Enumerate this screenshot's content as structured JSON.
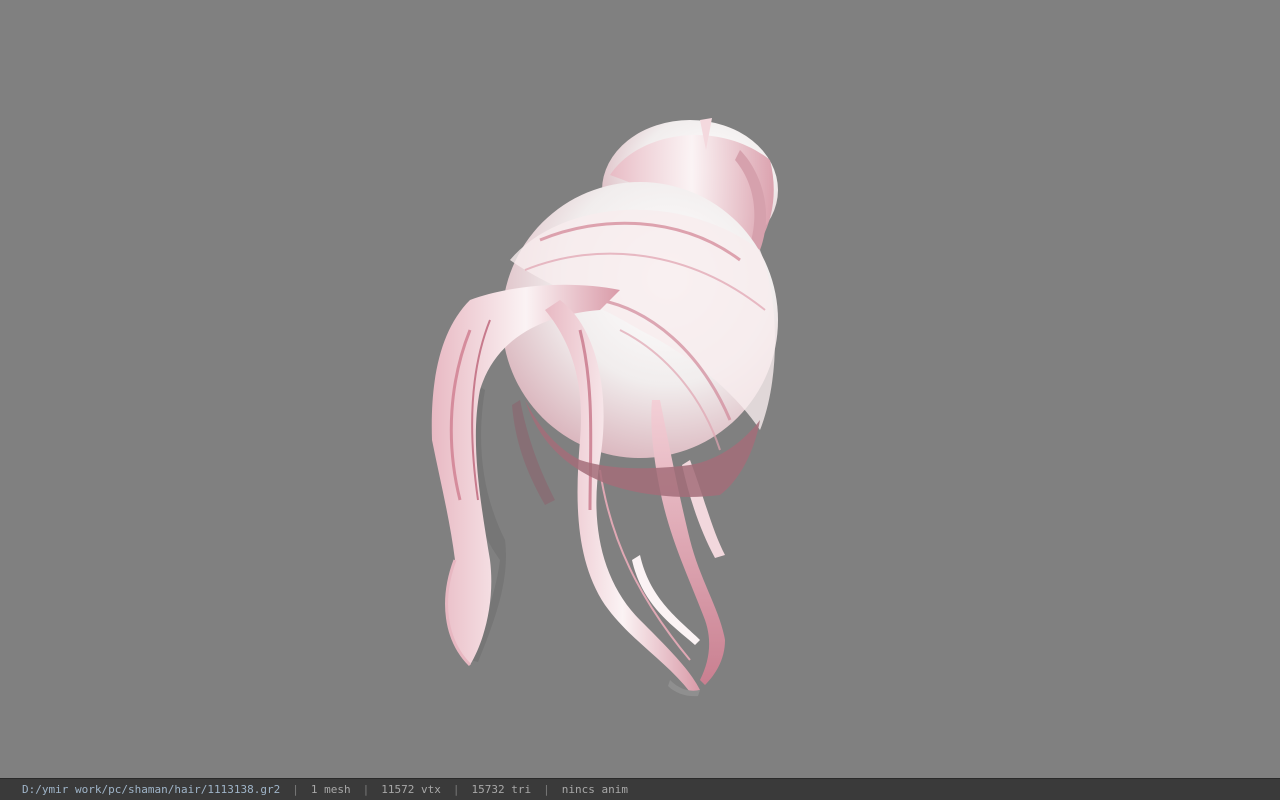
{
  "viewer": {
    "background_color": "#808080",
    "model_icon": "hair-model-3d"
  },
  "status": {
    "file_path": "D:/ymir work/pc/shaman/hair/1113138.gr2",
    "mesh_count": "1 mesh",
    "vertex_count": "11572 vtx",
    "triangle_count": "15732 tri",
    "anim_status": "nincs anim",
    "separator": "|"
  }
}
